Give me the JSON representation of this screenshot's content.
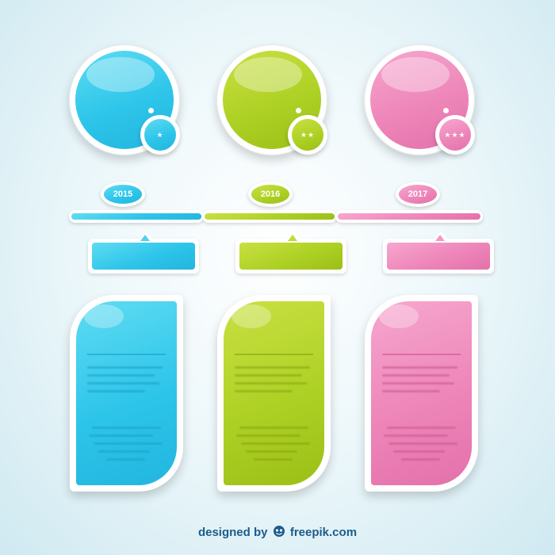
{
  "steps": [
    {
      "year": "2015",
      "stars": "★",
      "color": "#2ec5ea"
    },
    {
      "year": "2016",
      "stars": "★★",
      "color": "#aed125"
    },
    {
      "year": "2017",
      "stars": "★★★",
      "color": "#ee86b9"
    }
  ],
  "footer": {
    "prefix": "designed by",
    "brand": "freepik.com"
  },
  "colors": {
    "cyan": "#2ec5ea",
    "lime": "#aed125",
    "pink": "#ee86b9",
    "footer": "#1b5c8c"
  }
}
